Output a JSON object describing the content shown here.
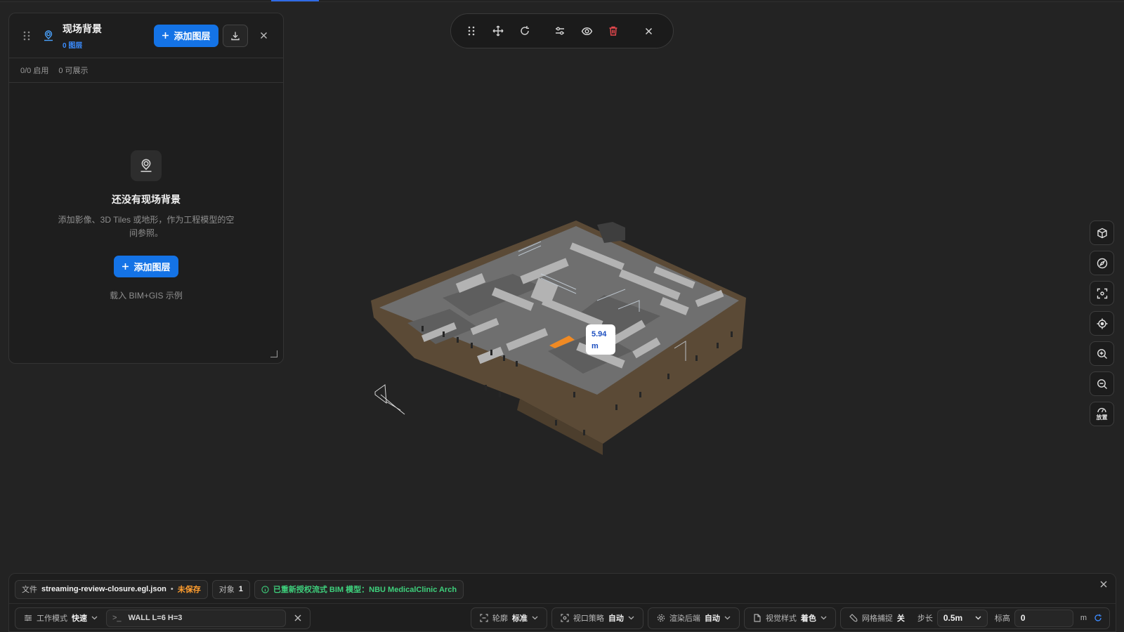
{
  "panel": {
    "title": "现场背景",
    "layer_count": "0 图层",
    "add_layer_label": "添加图层",
    "stats_enabled": "0/0 启用",
    "stats_visible": "0 可展示",
    "empty_title": "还没有现场背景",
    "empty_desc": "添加影像、3D Tiles 或地形，作为工程模型的空间参照。",
    "empty_add_label": "添加图层",
    "demo_link": "载入 BIM+GIS 示例"
  },
  "measure": {
    "value": "5.94",
    "unit": "m"
  },
  "right_tools": {
    "zoom_reset_label": "放置"
  },
  "status": {
    "file_label": "文件",
    "file_name": "streaming-review-closure.egl.json",
    "file_sep": "•",
    "file_state": "未保存",
    "object_label": "对象",
    "object_count": "1",
    "notice": "已重新授权流式 BIM 模型：NBU MedicalClinic Arch"
  },
  "controls": {
    "work_mode_label": "工作模式",
    "work_mode_value": "快速",
    "command_prompt": ">_",
    "command_text": "WALL L=6 H=3",
    "outline_label": "轮廓",
    "outline_value": "标准",
    "viewport_label": "视口策略",
    "viewport_value": "自动",
    "render_label": "渲染后端",
    "render_value": "自动",
    "visual_label": "视觉样式",
    "visual_value": "着色",
    "snap_label": "网格捕捉",
    "snap_value": "关",
    "step_label": "步长",
    "step_value": "0.5m",
    "elev_label": "标高",
    "elev_value": "0",
    "elev_unit": "m"
  }
}
